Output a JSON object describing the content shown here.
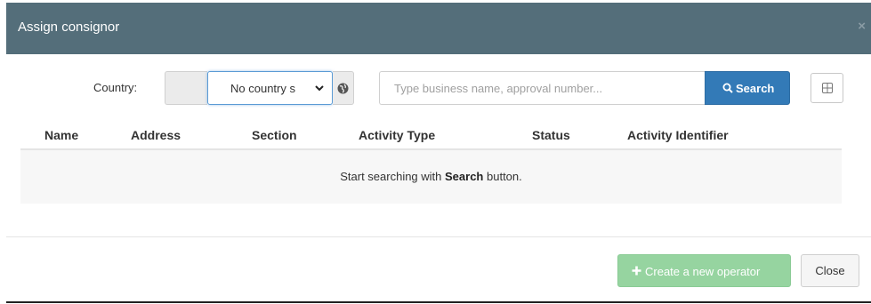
{
  "modal": {
    "title": "Assign consignor",
    "close_glyph": "×"
  },
  "filters": {
    "country_label": "Country:",
    "country_selected": "No country s",
    "search_placeholder": "Type business name, approval number...",
    "search_button_label": "Search"
  },
  "table": {
    "columns": [
      "Name",
      "Address",
      "Section",
      "Activity Type",
      "Status",
      "Activity Identifier"
    ],
    "empty_prefix": "Start searching with ",
    "empty_bold": "Search",
    "empty_suffix": " button."
  },
  "footer": {
    "create_label": "Create a new operator",
    "close_label": "Close"
  },
  "colors": {
    "header_bg": "#546e7a",
    "primary": "#337ab7",
    "success_disabled": "#96d4a0"
  },
  "icons": {
    "chevron": "chevron-down-icon",
    "globe": "globe-icon",
    "search": "search-icon",
    "grid": "grid-icon",
    "plus": "plus-icon"
  }
}
